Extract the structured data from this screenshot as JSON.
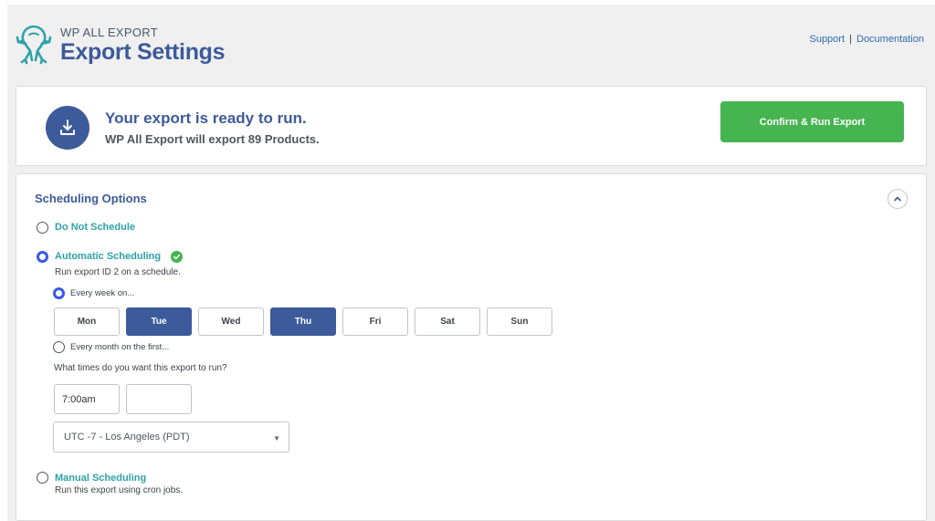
{
  "header": {
    "brand": "WP ALL EXPORT",
    "title": "Export Settings",
    "links": {
      "support": "Support",
      "separator": "|",
      "documentation": "Documentation"
    }
  },
  "ready": {
    "title": "Your export is ready to run.",
    "subtitle": "WP All Export will export 89 Products.",
    "button": "Confirm & Run Export",
    "icon": "download-icon"
  },
  "scheduling": {
    "title": "Scheduling Options",
    "options": [
      {
        "label": "Do Not Schedule",
        "selected": false
      },
      {
        "label": "Automatic Scheduling",
        "selected": true,
        "description": "Run export ID 2 on a schedule."
      },
      {
        "label": "Manual Scheduling",
        "selected": false,
        "description": "Run this export using cron jobs."
      }
    ],
    "weekly_label": "Every week on...",
    "weekly_selected": true,
    "days": [
      {
        "label": "Mon",
        "active": false
      },
      {
        "label": "Tue",
        "active": true
      },
      {
        "label": "Wed",
        "active": false
      },
      {
        "label": "Thu",
        "active": true
      },
      {
        "label": "Fri",
        "active": false
      },
      {
        "label": "Sat",
        "active": false
      },
      {
        "label": "Sun",
        "active": false
      }
    ],
    "monthly_label": "Every month on the first...",
    "times_question": "What times do you want this export to run?",
    "times": [
      "7:00am",
      ""
    ],
    "timezone": "UTC -7 - Los Angeles (PDT)"
  },
  "colors": {
    "primary": "#3d5a9a",
    "accent_teal": "#2ea2a8",
    "success": "#46b450",
    "link": "#2f69b3"
  }
}
